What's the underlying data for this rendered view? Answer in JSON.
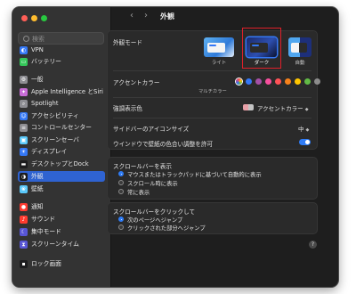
{
  "traffic_lights": [
    "#ff5f57",
    "#febc2e",
    "#28c840"
  ],
  "search": {
    "placeholder": "検索"
  },
  "sidebar": {
    "items": [
      {
        "label": "VPN",
        "icon": "vpn-icon",
        "glyph": "◐",
        "color": "#3478f6"
      },
      {
        "label": "バッテリー",
        "icon": "battery-icon",
        "glyph": "▭",
        "color": "#34c759"
      },
      {
        "label": "一般",
        "icon": "gear-icon",
        "glyph": "⚙",
        "color": "#8e8e93"
      },
      {
        "label": "Apple Intelligence とSiri",
        "icon": "apple-intelligence-icon",
        "glyph": "✦",
        "color": "#c86dd7"
      },
      {
        "label": "Spotlight",
        "icon": "magnifier-icon",
        "glyph": "⌕",
        "color": "#8e8e93"
      },
      {
        "label": "アクセシビリティ",
        "icon": "accessibility-icon",
        "glyph": "☺",
        "color": "#3478f6"
      },
      {
        "label": "コントロールセンター",
        "icon": "control-center-icon",
        "glyph": "≡",
        "color": "#8e8e93"
      },
      {
        "label": "スクリーンセーバ",
        "icon": "screensaver-icon",
        "glyph": "▣",
        "color": "#5ac8fa"
      },
      {
        "label": "ディスプレイ",
        "icon": "display-icon",
        "glyph": "☀",
        "color": "#3478f6"
      },
      {
        "label": "デスクトップとDock",
        "icon": "dock-icon",
        "glyph": "▬",
        "color": "#1c1c1e"
      },
      {
        "label": "外観",
        "icon": "appearance-icon",
        "glyph": "◑",
        "color": "#1c1c1e"
      },
      {
        "label": "壁紙",
        "icon": "wallpaper-icon",
        "glyph": "❀",
        "color": "#5ac8fa"
      },
      {
        "label": "通知",
        "icon": "bell-icon",
        "glyph": "●",
        "color": "#ff3b30"
      },
      {
        "label": "サウンド",
        "icon": "speaker-icon",
        "glyph": "♪",
        "color": "#ff3b30"
      },
      {
        "label": "集中モード",
        "icon": "moon-icon",
        "glyph": "☾",
        "color": "#5856d6"
      },
      {
        "label": "スクリーンタイム",
        "icon": "hourglass-icon",
        "glyph": "⧗",
        "color": "#5856d6"
      },
      {
        "label": "ロック画面",
        "icon": "lock-icon",
        "glyph": "▪",
        "color": "#1c1c1e"
      }
    ],
    "selected_index": 10
  },
  "header": {
    "title": "外観",
    "back": "‹",
    "forward": "›"
  },
  "appearance": {
    "label": "外観モード",
    "options": [
      {
        "caption": "ライト",
        "icon": "light-mode-thumbnail"
      },
      {
        "caption": "ダーク",
        "icon": "dark-mode-thumbnail",
        "selected": true
      },
      {
        "caption": "自動",
        "icon": "auto-mode-thumbnail"
      }
    ],
    "highlight_color": "#e0202a"
  },
  "accent": {
    "label": "アクセントカラー",
    "caption": "マルチカラー",
    "colors": [
      "multicolor",
      "#3478f6",
      "#a550a7",
      "#f74f9e",
      "#ff5257",
      "#f7821b",
      "#ffc600",
      "#62ba46",
      "#8c8c8c"
    ]
  },
  "highlight": {
    "label": "強調表示色",
    "value": "アクセントカラー",
    "swatch_color": "#e8a0a8"
  },
  "sidebar_icon_size": {
    "label": "サイドバーのアイコンサイズ",
    "value": "中"
  },
  "wallpaper_tint": {
    "label": "ウインドウで壁紙の色合い調整を許可",
    "enabled": true
  },
  "scrollbars_show": {
    "label": "スクロールバーを表示",
    "options": [
      "マウスまたはトラックパッドに基づいて自動的に表示",
      "スクロール時に表示",
      "常に表示"
    ],
    "selected": 0
  },
  "scrollbar_click": {
    "label": "スクロールバーをクリックして",
    "options": [
      "次のページへジャンプ",
      "クリックされた部分へジャンプ"
    ],
    "selected": 0
  },
  "help": "?"
}
